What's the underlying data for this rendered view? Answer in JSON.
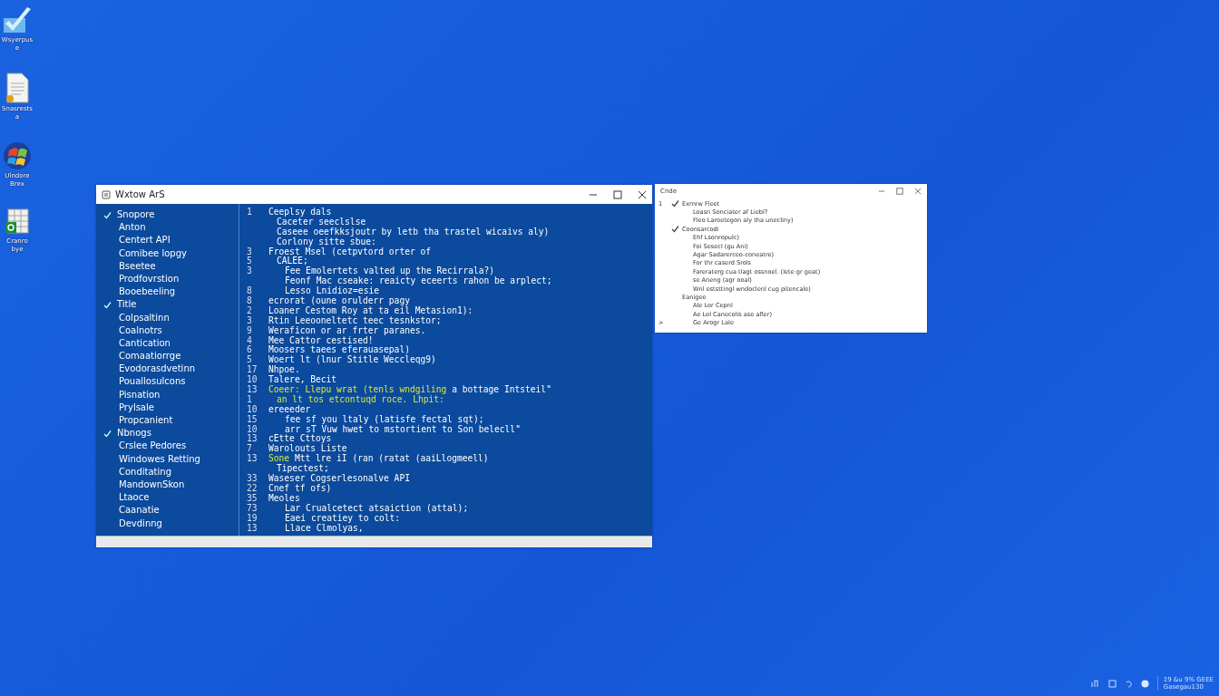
{
  "desktop_icons": [
    {
      "kind": "check",
      "label": "Wsyerpus e"
    },
    {
      "kind": "document",
      "label": "Snasrests a"
    },
    {
      "kind": "orb",
      "label": "Ulndore Brex"
    },
    {
      "kind": "sheet",
      "label": "Cranro bye"
    }
  ],
  "main_window": {
    "title": "Wxtow ArS",
    "sidebar": [
      {
        "label": "Snopore",
        "expanded": true,
        "children": [
          "Anton",
          "Centert API",
          "Comibee lopgy",
          "Bseetee",
          "Prodfovrstion",
          "Booebeeling"
        ]
      },
      {
        "label": "Title",
        "expanded": true,
        "children": [
          "Colpsaltinn",
          "Coalnotrs",
          "Cantication",
          "Comaatiorrge",
          "Evodorasdvetinn",
          "Pouallosulcons",
          "Pisnation",
          "Prylsale",
          "Propcanient"
        ]
      },
      {
        "label": "Nbnogs",
        "expanded": true,
        "children": [
          "Crslee Pedores",
          "Windowes Retting",
          "Conditating",
          "MandownSkon",
          "Ltaoce",
          "Caanatie",
          "Devdinng"
        ]
      }
    ],
    "code_lines": [
      {
        "number": "1",
        "text": "Ceeplsy dals",
        "kind": "statement"
      },
      {
        "text": "Caceter seeclslse",
        "kind": "nested"
      },
      {
        "text": "Caseee oeefkksjoutr by letb tha trastel wicaivs aly)",
        "kind": "nested"
      },
      {
        "text": "Corlony sitte sbue:",
        "kind": "nested"
      },
      {
        "number": "3",
        "text": "Froest Msel (cetpvtord orter of",
        "kind": "statement"
      },
      {
        "number": "5",
        "text": "CALEE;",
        "kind": "nested"
      },
      {
        "number": "3",
        "text": "Fee Emolertets valted up the Recirrala?)",
        "kind": "deep"
      },
      {
        "text": "Feonf Mac cseake: reaicty eceerts rahon be arplect;",
        "kind": "deep"
      },
      {
        "number": "8",
        "text": "Lesso Lnidioz=esie",
        "kind": "deep"
      },
      {
        "number": "8",
        "text": "ecrorat (oune orulderr pagy",
        "kind": "statement"
      },
      {
        "number": "2",
        "text": "Loaner Cestom Roy at ta eil Metasion1):",
        "kind": "statement"
      },
      {
        "number": "3",
        "text": "Rtin Leeooneltetc teec tesnkstor;",
        "kind": "statement"
      },
      {
        "number": "9",
        "text": "Weraficon or ar frter paranes.",
        "kind": "statement"
      },
      {
        "number": "4",
        "text": "Mee Cattor cestised!",
        "kind": "statement"
      },
      {
        "number": "6",
        "text": "Moosers taees eferauasepal)",
        "kind": "statement"
      },
      {
        "number": "5",
        "text": "Woert lt (lnur Stitle Weccleqg9)",
        "kind": "statement"
      },
      {
        "number": "17",
        "text": "Nhpoe.",
        "kind": "statement"
      },
      {
        "number": "10",
        "text": "Talere, Becit",
        "kind": "statement"
      },
      {
        "number": "13",
        "accent": "Coeer: Llepu wrat (tenls wndgiling",
        "text": " a bottage Intsteil\"",
        "kind": "statement"
      },
      {
        "number": "1",
        "accent": "an lt tos etcontuqd roce. Lhpit:",
        "kind": "nested"
      },
      {
        "number": "10",
        "text": "ereeeder",
        "kind": "statement"
      },
      {
        "number": "15",
        "text": "fee sf you ltaly (latisfe fectal sqt);",
        "kind": "deep"
      },
      {
        "number": "10",
        "text": "arr sT Vuw hwet to mstortient to Son belecll\"",
        "kind": "deep"
      },
      {
        "number": "13",
        "text": "cEtte Cttoys",
        "kind": "statement"
      },
      {
        "number": "7",
        "text": "Warolouts Liste",
        "kind": "statement"
      },
      {
        "number": "13",
        "accent": "Sone",
        "text": " Mtt lre iI (ran (ratat (aaiLlogmeell)",
        "kind": "statement"
      },
      {
        "text": "Tipectest;",
        "kind": "nested"
      },
      {
        "number": "33",
        "text": "Waseser Cogserlesonalve API",
        "kind": "statement"
      },
      {
        "number": "22",
        "text": "Cnef tf ofs)",
        "kind": "statement"
      },
      {
        "number": "35",
        "text": "Meoles",
        "kind": "statement"
      },
      {
        "number": "73",
        "text": "Lar Crualcetect atsaiction  (attal);",
        "kind": "deep"
      },
      {
        "number": "19",
        "text": "Eaei creatiey to colt:",
        "kind": "deep"
      },
      {
        "number": "13",
        "text": "Llace Clmolyas,",
        "kind": "deep"
      }
    ]
  },
  "side_window": {
    "title": "Cnde",
    "lines": [
      {
        "number": "1",
        "text": "Exrnrw Fleet",
        "kind": "nested",
        "expanded": true
      },
      {
        "text": "Loasn Sonciater af Liebl?",
        "kind": "deep"
      },
      {
        "text": "Fleo Laroetegon aly tha unecliny)",
        "kind": "deep"
      },
      {
        "text": "Coonsarcodi",
        "kind": "nested",
        "expanded": true
      },
      {
        "text": "Ehf Lsonropulc)",
        "kind": "deep"
      },
      {
        "text": "Foi Sesecl (gu Ani)",
        "kind": "deep"
      },
      {
        "text": "Agar Sadarerceo-coneatre)",
        "kind": "deep"
      },
      {
        "text": "For thr caserd Srols",
        "kind": "deep"
      },
      {
        "text": "Fareraterg cua tlagt ossnoel. (lete gr geat)",
        "kind": "deep"
      },
      {
        "text": "se Aneng (agr ooal)",
        "kind": "deep"
      },
      {
        "text": "Wnl eststtingl wndoclenl cug pitencale)",
        "kind": "deep"
      },
      {
        "text": "Eanigee",
        "kind": "nested"
      },
      {
        "text": "Ale Lor Cepnl",
        "kind": "deep"
      },
      {
        "text": "Ae Lol Canecolis ase afler)",
        "kind": "deep"
      },
      {
        "number": ">",
        "text": "Ge Arogr Lale",
        "kind": "deep"
      }
    ]
  },
  "tray": {
    "clock": [
      "19 &u 9% GEEE",
      "Gasegau130"
    ]
  }
}
